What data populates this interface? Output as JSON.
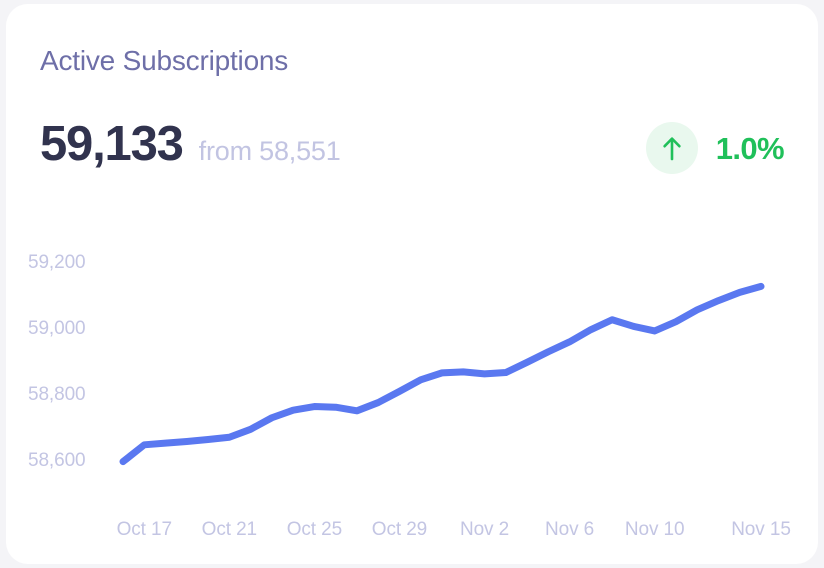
{
  "card": {
    "title": "Active Subscriptions",
    "value": "59,133",
    "compare_label": "from 58,551",
    "delta": {
      "value": "1.0%",
      "direction": "up",
      "icon": "arrow-up-icon",
      "color": "#20c05a",
      "badge_bg": "#e9f8ee"
    },
    "accent_color": "#5a78f0",
    "title_color": "#6e6fa8",
    "value_color": "#31334e",
    "muted_color": "#c3c5e3"
  },
  "chart_data": {
    "type": "line",
    "title": "Active Subscriptions",
    "xlabel": "",
    "ylabel": "",
    "grid": false,
    "legend": null,
    "ylim": [
      58500,
      59260
    ],
    "yticks": [
      "58,600",
      "58,800",
      "59,000",
      "59,200"
    ],
    "ytick_values": [
      58600,
      58800,
      59000,
      59200
    ],
    "xticks": [
      "Oct 17",
      "Oct 21",
      "Oct 25",
      "Oct 29",
      "Nov 2",
      "Nov 6",
      "Nov 10",
      "Nov 15"
    ],
    "xtick_positions": [
      1,
      5,
      9,
      13,
      17,
      21,
      25,
      30
    ],
    "series": [
      {
        "name": "Active Subscriptions",
        "color": "#5a78f0",
        "x": [
          "Oct 16",
          "Oct 17",
          "Oct 18",
          "Oct 19",
          "Oct 20",
          "Oct 21",
          "Oct 22",
          "Oct 23",
          "Oct 24",
          "Oct 25",
          "Oct 26",
          "Oct 27",
          "Oct 28",
          "Oct 29",
          "Oct 30",
          "Oct 31",
          "Nov 1",
          "Nov 2",
          "Nov 3",
          "Nov 4",
          "Nov 5",
          "Nov 6",
          "Nov 7",
          "Nov 8",
          "Nov 9",
          "Nov 10",
          "Nov 11",
          "Nov 12",
          "Nov 13",
          "Nov 14",
          "Nov 15"
        ],
        "values": [
          58592,
          58643,
          58648,
          58653,
          58659,
          58666,
          58690,
          58725,
          58748,
          58759,
          58757,
          58746,
          58771,
          58805,
          58840,
          58861,
          58864,
          58858,
          58862,
          58893,
          58925,
          58955,
          58992,
          59022,
          59002,
          58988,
          59016,
          59052,
          59080,
          59105,
          59123
        ]
      }
    ]
  }
}
